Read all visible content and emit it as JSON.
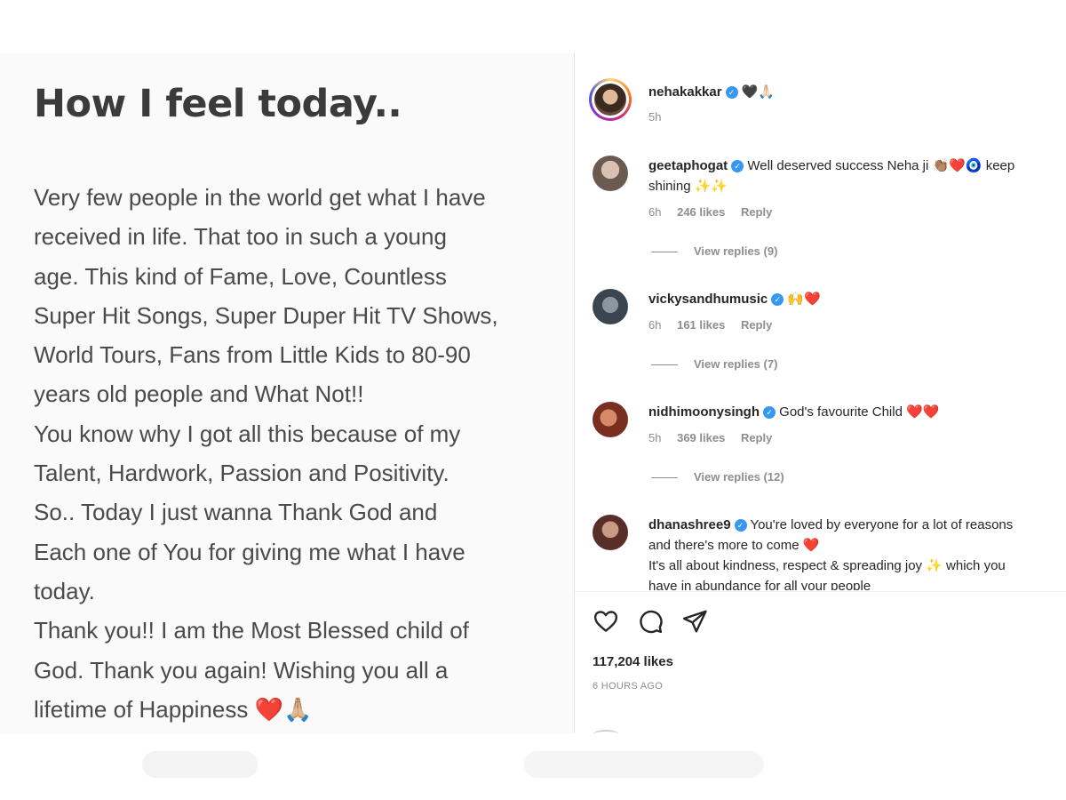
{
  "left_panel": {
    "heading": "How I feel today..",
    "lines": [
      "Very few people in the world get what I have",
      "received in life. That too in such a young",
      "age. This kind of Fame, Love, Countless",
      "Super Hit Songs, Super Duper Hit TV Shows,",
      "World Tours, Fans from Little Kids to 80-90",
      "years old people and What Not!!",
      "You know why I got all this because of my",
      "Talent, Hardwork, Passion and Positivity.",
      "So.. Today I just wanna Thank God and",
      "Each one of You for giving me what I have",
      "today.",
      "Thank you!! I am the Most Blessed child of",
      "God. Thank you again! Wishing you all a",
      "lifetime of Happiness"
    ],
    "last_line_emoji": "❤️🙏🏼"
  },
  "author": {
    "username": "nehakakkar",
    "caption_emoji": "🖤🙏🏻",
    "time": "5h",
    "verified_icon": "verified-badge-icon"
  },
  "comments": [
    {
      "username": "geetaphogat",
      "lines": [
        "Well deserved success Neha ji 👏🏽❤️🧿 keep",
        "shining ✨✨"
      ],
      "time": "6h",
      "likes": "246 likes",
      "reply": "Reply",
      "view_replies": "View replies (9)",
      "avatar_color": "#b89a86"
    },
    {
      "username": "vickysandhumusic",
      "lines": [
        "🙌❤️"
      ],
      "time": "6h",
      "likes": "161 likes",
      "reply": "Reply",
      "view_replies": "View replies (7)",
      "avatar_color": "#5b6a78"
    },
    {
      "username": "nidhimoonysingh",
      "lines": [
        "God's favourite Child ❤️❤️"
      ],
      "time": "5h",
      "likes": "369 likes",
      "reply": "Reply",
      "view_replies": "View replies (12)",
      "avatar_color": "#a8563e"
    },
    {
      "username": "dhanashree9",
      "lines": [
        "You're loved by everyone for a lot of reasons",
        "and there's more to come ❤️",
        "It's all about kindness, respect & spreading joy ✨ which you",
        "have in abundance for all your people"
      ],
      "avatar_color": "#7a4a3c"
    }
  ],
  "actions": {
    "like_icon": "heart-icon",
    "comment_icon": "comment-icon",
    "share_icon": "share-icon"
  },
  "likes_count": "117,204 likes",
  "post_time": "6 HOURS AGO",
  "colors": {
    "verified": "#3897f0",
    "text": "#262626",
    "muted": "#8e8e8e",
    "heart": "#e0262f"
  }
}
